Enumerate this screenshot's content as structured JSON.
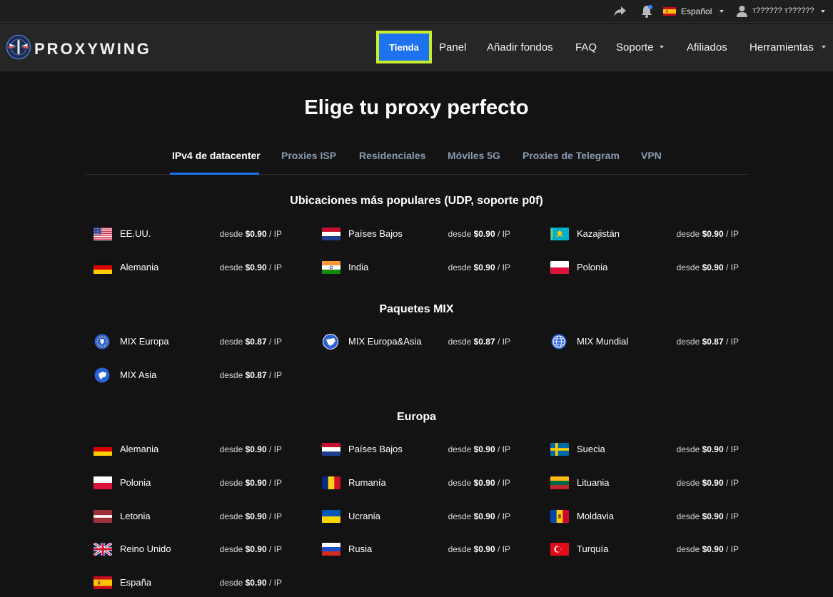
{
  "utilbar": {
    "language": "Español",
    "user": "т?????? т??????"
  },
  "navbar": {
    "brand": "PROXYWING",
    "shop": "Tienda",
    "items": [
      "Panel",
      "Añadir fondos",
      "FAQ",
      "Soporte",
      "Afiliados",
      "Herramientas"
    ]
  },
  "main": {
    "title": "Elige tu proxy perfecto",
    "tabs": [
      "IPv4 de datacenter",
      "Proxies ISP",
      "Residenciales",
      "Móviles 5G",
      "Proxies de Telegram",
      "VPN"
    ],
    "active_tab": "IPv4 de datacenter"
  },
  "pricing": {
    "from": "desde",
    "per": "/ IP"
  },
  "sections": [
    {
      "title": "Ubicaciones más populares (UDP, soporte p0f)",
      "items": [
        {
          "name": "EE.UU.",
          "price": "$0.90",
          "icon": "us"
        },
        {
          "name": "Países Bajos",
          "price": "$0.90",
          "icon": "nl"
        },
        {
          "name": "Kazajistán",
          "price": "$0.90",
          "icon": "kz"
        },
        {
          "name": "Alemania",
          "price": "$0.90",
          "icon": "de"
        },
        {
          "name": "India",
          "price": "$0.90",
          "icon": "in"
        },
        {
          "name": "Polonia",
          "price": "$0.90",
          "icon": "pl"
        }
      ]
    },
    {
      "title": "Paquetes MIX",
      "items": [
        {
          "name": "MIX Europa",
          "price": "$0.87",
          "icon": "globe-europe"
        },
        {
          "name": "MIX Europa&Asia",
          "price": "$0.87",
          "icon": "globe-eurasia"
        },
        {
          "name": "MIX Mundial",
          "price": "$0.87",
          "icon": "globe-world"
        },
        {
          "name": "MIX Asia",
          "price": "$0.87",
          "icon": "globe-asia"
        }
      ]
    },
    {
      "title": "Europa",
      "items": [
        {
          "name": "Alemania",
          "price": "$0.90",
          "icon": "de"
        },
        {
          "name": "Países Bajos",
          "price": "$0.90",
          "icon": "nl"
        },
        {
          "name": "Suecia",
          "price": "$0.90",
          "icon": "se"
        },
        {
          "name": "Polonia",
          "price": "$0.90",
          "icon": "pl"
        },
        {
          "name": "Rumanía",
          "price": "$0.90",
          "icon": "ro"
        },
        {
          "name": "Lituania",
          "price": "$0.90",
          "icon": "lt"
        },
        {
          "name": "Letonia",
          "price": "$0.90",
          "icon": "lv"
        },
        {
          "name": "Ucrania",
          "price": "$0.90",
          "icon": "ua"
        },
        {
          "name": "Moldavia",
          "price": "$0.90",
          "icon": "md"
        },
        {
          "name": "Reino Unido",
          "price": "$0.90",
          "icon": "gb"
        },
        {
          "name": "Rusia",
          "price": "$0.90",
          "icon": "ru"
        },
        {
          "name": "Turquía",
          "price": "$0.90",
          "icon": "tr"
        },
        {
          "name": "España",
          "price": "$0.90",
          "icon": "es"
        }
      ]
    }
  ],
  "colors": {
    "accent": "#1d72f0",
    "highlight_frame": "#c8f02a",
    "background": "#131313"
  }
}
